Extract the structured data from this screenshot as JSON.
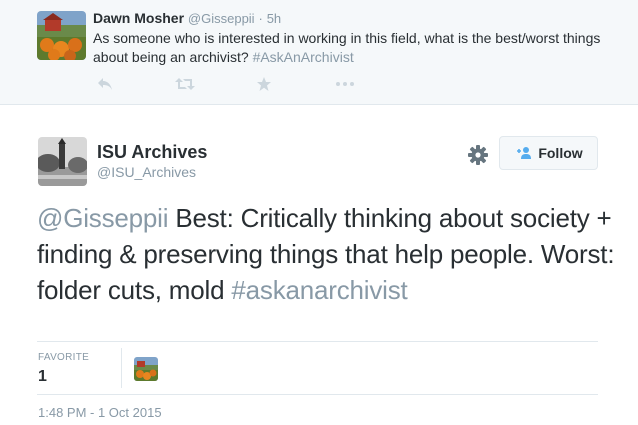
{
  "reply_tweet": {
    "author_name": "Dawn Mosher",
    "author_handle": "@Gisseppii",
    "separator": "·",
    "time": "5h",
    "text": "As someone who is interested in working in this field, what is the best/worst things about being an archivist?",
    "hashtag": "#AskAnArchivist",
    "avatar_icon": "pumpkin-patch-photo",
    "actions": [
      "reply-icon",
      "retweet-icon",
      "favorite-star-icon",
      "more-icon"
    ]
  },
  "main_tweet": {
    "author_name": "ISU Archives",
    "author_handle": "@ISU_Archives",
    "avatar_icon": "campanile-photo",
    "follow_label": "Follow",
    "mention": "@Gisseppii",
    "text": "Best: Critically thinking about society + finding & preserving things that help people. Worst: folder cuts, mold",
    "hashtag": "#askanarchivist",
    "favorite_label": "FAVORITE",
    "favorite_count": "1",
    "timestamp": "1:48 PM - 1 Oct 2015"
  },
  "colors": {
    "muted": "#8899a6",
    "text": "#292f33",
    "reply_bg": "#f5f8fa",
    "divider": "#e1e8ed"
  }
}
